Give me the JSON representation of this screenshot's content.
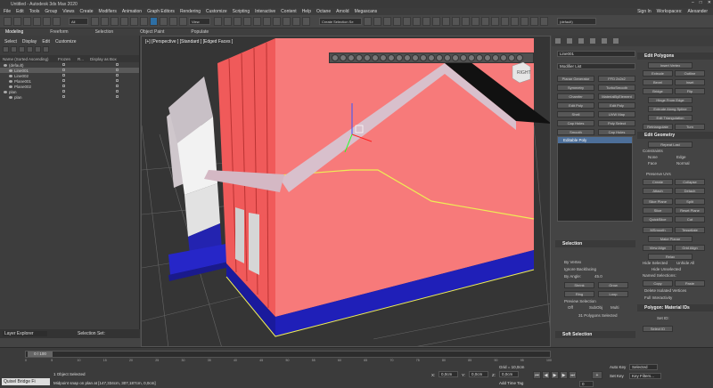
{
  "window": {
    "title": "Untitled - Autodesk 3ds Max 2020"
  },
  "menu": [
    "File",
    "Edit",
    "Tools",
    "Group",
    "Views",
    "Create",
    "Modifiers",
    "Animation",
    "Graph Editors",
    "Rendering",
    "Customize",
    "Scripting",
    "Interactive",
    "Content",
    "Help",
    "Octane",
    "Arnold",
    "Megascans"
  ],
  "menu_right": {
    "signin": "Sign In",
    "workspaces_label": "Workspaces:",
    "workspace_value": "Alexander"
  },
  "toolbar": {
    "filter_value": "All",
    "view_value": "View",
    "selection_set": "Create Selection Se",
    "default_layer": "(default)"
  },
  "ribbon": {
    "tabs": [
      "Modeling",
      "Freeform",
      "Selection",
      "Object Paint",
      "Populate"
    ]
  },
  "scene_explorer": {
    "tabs": [
      "Select",
      "Display",
      "Edit",
      "Customize"
    ],
    "columns": [
      "Name (Sorted Ascending)",
      "Frozen",
      "R...",
      "Display as Box"
    ],
    "rows": [
      {
        "label": "(default)",
        "indent": 0,
        "selected": false
      },
      {
        "label": "Line001",
        "indent": 1,
        "selected": true
      },
      {
        "label": "Line002",
        "indent": 1,
        "selected": false
      },
      {
        "label": "Plane001",
        "indent": 1,
        "selected": false
      },
      {
        "label": "Plane002",
        "indent": 1,
        "selected": false
      },
      {
        "label": "plan",
        "indent": 0,
        "selected": false
      },
      {
        "label": "plan",
        "indent": 1,
        "selected": false
      }
    ],
    "layer_explorer": "Layer Explorer",
    "selection_set": "Selection Set:"
  },
  "viewport": {
    "label": "[+] [Perspective ] [Standard ] [Edged Faces ]",
    "viewcube_label": "RIGHT"
  },
  "command_panel": {
    "object_name": "Line001",
    "modifier_list": "Modifier List",
    "modifier_buttons": [
      "Planar Generator",
      "FFD 2x2x2",
      "Symmetry",
      "TurboSmooth",
      "Chamfer",
      "MaterialByElement",
      "Edit Poly",
      "Edit Poly",
      "Shell",
      "UVW Map",
      "Cap Holes",
      "Poly Select",
      "Smooth",
      "Cap Holes"
    ],
    "stack_item": "Editable Poly",
    "rollouts": {
      "edit_polygons": {
        "title": "Edit Polygons",
        "insert_vertex": "Insert Vertex",
        "buttons": [
          "Extrude",
          "Outline",
          "Bevel",
          "Inset",
          "Bridge",
          "Flip",
          "Hinge From Edge",
          "Extrude Along Spline",
          "Edit Triangulation",
          "Retriangulate",
          "Turn"
        ]
      },
      "edit_geometry": {
        "title": "Edit Geometry",
        "repeat_last": "Repeat Last",
        "constraints": "Constraints",
        "none": "None",
        "edge": "Edge",
        "face": "Face",
        "normal": "Normal",
        "preserve_uvs": "Preserve UVs",
        "create": "Create",
        "collapse": "Collapse",
        "attach": "Attach",
        "detach": "Detach",
        "slice_plane": "Slice Plane",
        "split": "Split",
        "slice": "Slice",
        "reset_plane": "Reset Plane",
        "quickslice": "QuickSlice",
        "cut": "Cut",
        "msmooth": "MSmooth",
        "tessellate": "Tessellate",
        "make_planar": "Make Planar",
        "view_align": "View Align",
        "grid_align": "Grid Align",
        "relax": "Relax",
        "hide_selected": "Hide Selected",
        "unhide_all": "Unhide All",
        "hide_unselected": "Hide Unselected",
        "named_selections": "Named Selections:",
        "copy": "Copy",
        "paste": "Paste",
        "delete_isolated": "Delete Isolated Vertices",
        "full_interactivity": "Full Interactivity"
      },
      "polygon_material": {
        "title": "Polygon: Material IDs",
        "set_id": "Set ID:",
        "select_id": "Select ID"
      },
      "selection": {
        "title": "Selection",
        "by_vertex": "By Vertex",
        "ignore_backfacing": "Ignore Backfacing",
        "by_angle": "By Angle:",
        "angle_value": "45.0",
        "shrink": "Shrink",
        "grow": "Grow",
        "ring": "Ring",
        "loop": "Loop",
        "preview": "Preview Selection",
        "off": "Off",
        "subobj": "SubObj",
        "multi": "Multi",
        "count": "31 Polygons Selected"
      },
      "soft_selection": {
        "title": "Soft Selection"
      }
    }
  },
  "timeline": {
    "frame": "0 / 100",
    "ticks": [
      "0",
      "5",
      "10",
      "15",
      "20",
      "25",
      "30",
      "35",
      "40",
      "45",
      "50",
      "55",
      "60",
      "65",
      "70",
      "75",
      "80",
      "85",
      "90",
      "95",
      "100"
    ]
  },
  "status": {
    "maxscript": "Quixel Bridge Fi",
    "line1": "1 Object Selected",
    "line2": "Midpoint snap on plan at [147,334cm, 307,187cm, 0,0cm]",
    "x_label": "X:",
    "x_value": "0,0cm",
    "y_label": "Y:",
    "y_value": "0,0cm",
    "z_label": "Z:",
    "z_value": "0,0cm",
    "grid": "Grid = 10,0cm",
    "add_time_tag": "Add Time Tag",
    "auto_key": "Auto Key",
    "selected": "Selected",
    "set_key": "Set Key",
    "key_filters": "Key Filters...",
    "frame_field": "0"
  }
}
